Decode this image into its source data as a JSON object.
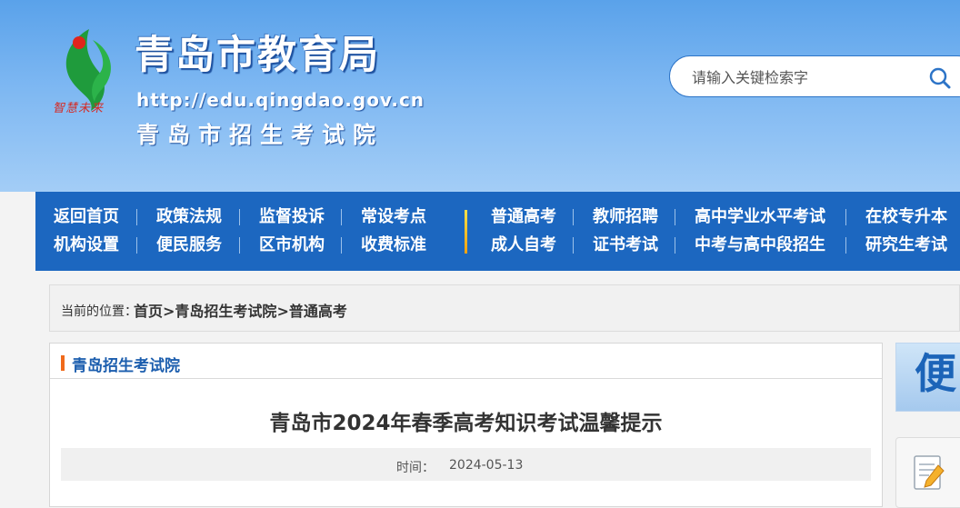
{
  "header": {
    "logo_slogan": "智慧未来",
    "site_title": "青岛市教育局",
    "site_url": "http://edu.qingdao.gov.cn",
    "site_subtitle": "青岛市招生考试院",
    "search": {
      "placeholder": "请输入关键检索字",
      "icon": "search-icon"
    }
  },
  "nav": {
    "row1": [
      "返回首页",
      "政策法规",
      "监督投诉",
      "常设考点",
      "普通高考",
      "教师招聘",
      "高中学业水平考试",
      "在校专升本"
    ],
    "row2": [
      "机构设置",
      "便民服务",
      "区市机构",
      "收费标准",
      "成人自考",
      "证书考试",
      "中考与高中段招生",
      "研究生考试"
    ]
  },
  "breadcrumb": {
    "label": "当前的位置：",
    "items": [
      "首页",
      "青岛招生考试院",
      "普通高考"
    ],
    "separator": ">"
  },
  "panel": {
    "title": "青岛招生考试院"
  },
  "article": {
    "title": "青岛市2024年春季高考知识考试温馨提示",
    "time_label": "时间：",
    "time_value": "2024-05-13"
  },
  "sidebar": {
    "banner_char": "便",
    "card_icon": "edit-document-icon"
  },
  "colors": {
    "nav_bg": "#1c67c0",
    "header_top": "#5aa2ea",
    "accent_orange": "#f06a1b",
    "panel_title": "#1c5eae"
  }
}
